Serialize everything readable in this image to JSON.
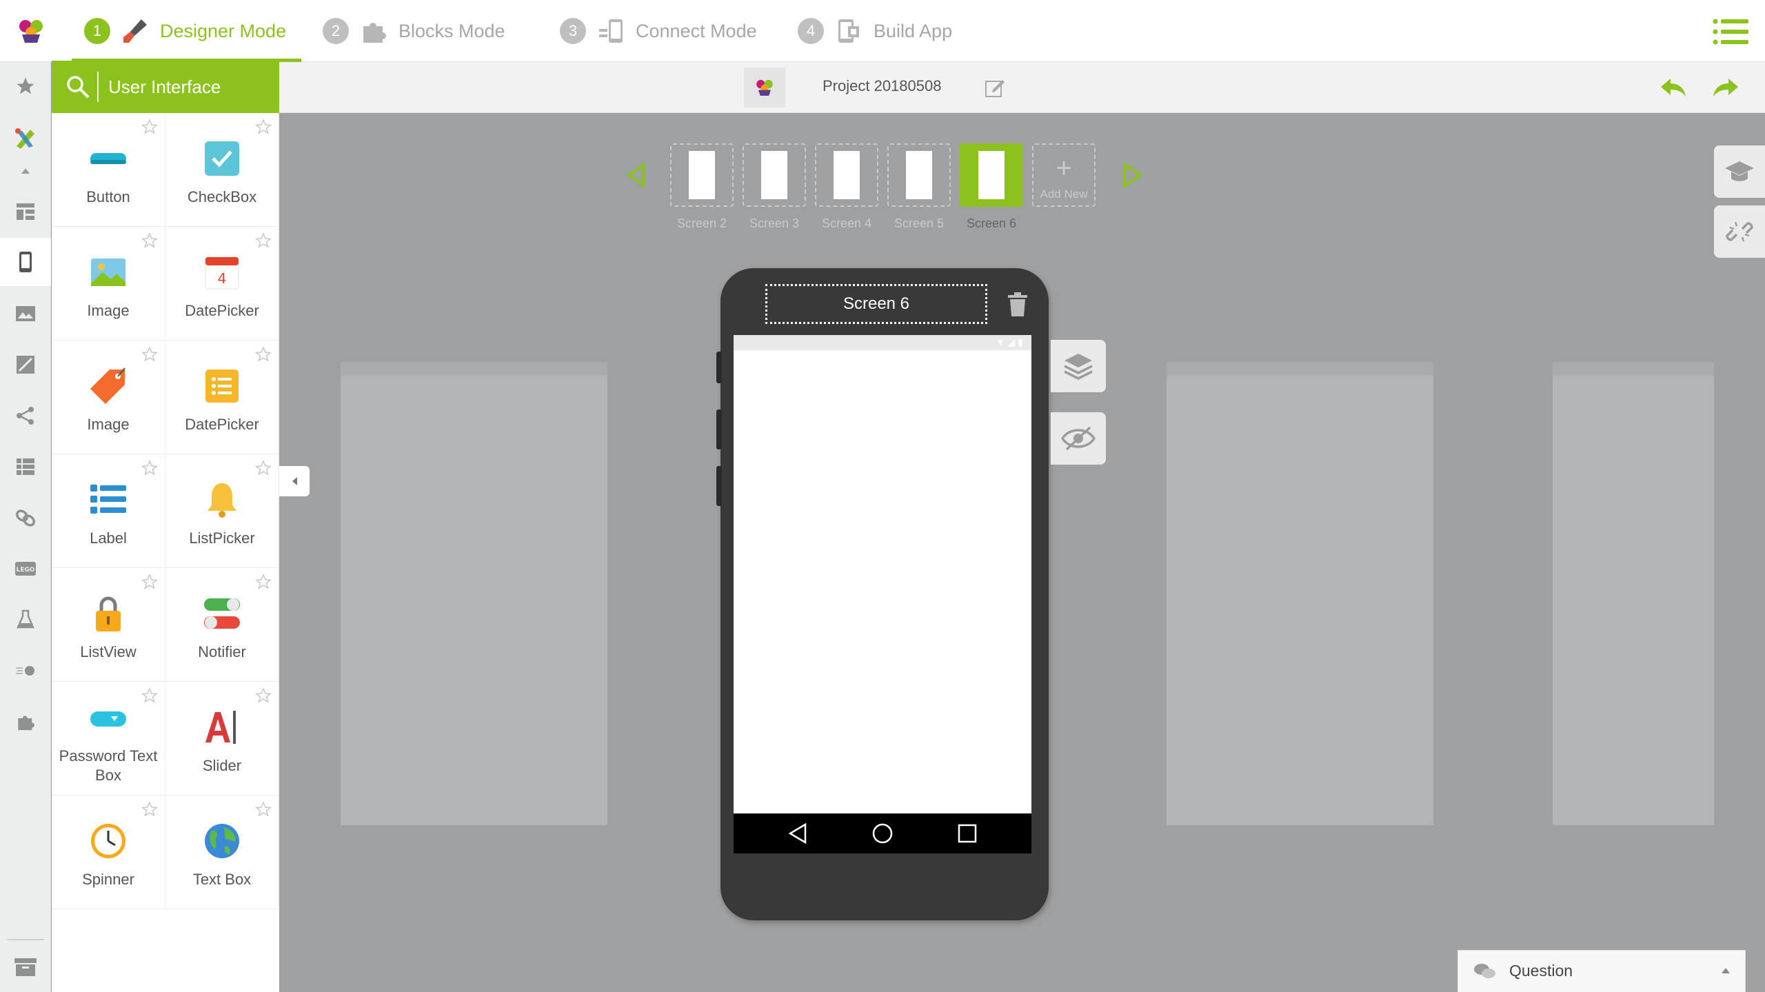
{
  "modes": [
    {
      "num": "1",
      "label": "Designer Mode",
      "icon": "paintbrush-icon",
      "active": true
    },
    {
      "num": "2",
      "label": "Blocks Mode",
      "icon": "puzzle-icon",
      "active": false
    },
    {
      "num": "3",
      "label": "Connect Mode",
      "icon": "connect-device-icon",
      "active": false
    },
    {
      "num": "4",
      "label": "Build App",
      "icon": "build-app-icon",
      "active": false
    }
  ],
  "palette": {
    "category": "User Interface",
    "items": [
      {
        "label": "Button",
        "icon": "button-icon"
      },
      {
        "label": "CheckBox",
        "icon": "checkbox-icon"
      },
      {
        "label": "Image",
        "icon": "image-icon"
      },
      {
        "label": "DatePicker",
        "icon": "calendar-icon"
      },
      {
        "label": "Image",
        "icon": "tag-icon"
      },
      {
        "label": "DatePicker",
        "icon": "list-note-icon"
      },
      {
        "label": "Label",
        "icon": "label-icon"
      },
      {
        "label": "ListPicker",
        "icon": "bell-icon"
      },
      {
        "label": "ListView",
        "icon": "lock-icon"
      },
      {
        "label": "Notifier",
        "icon": "toggle-icon"
      },
      {
        "label": "Password Text Box",
        "icon": "dropdown-icon"
      },
      {
        "label": "Slider",
        "icon": "text-cursor-icon"
      },
      {
        "label": "Spinner",
        "icon": "clock-icon"
      },
      {
        "label": "Text Box",
        "icon": "globe-icon"
      }
    ]
  },
  "project": {
    "name": "Project 20180508"
  },
  "screens": {
    "items": [
      {
        "label": "Screen 2",
        "active": false
      },
      {
        "label": "Screen 3",
        "active": false
      },
      {
        "label": "Screen 4",
        "active": false
      },
      {
        "label": "Screen 5",
        "active": false
      },
      {
        "label": "Screen 6",
        "active": true
      }
    ],
    "add_new": "Add New",
    "current": "Screen 6"
  },
  "question": {
    "label": "Question"
  },
  "colors": {
    "accent": "#8cc21d",
    "background": "#9fa0a2",
    "phone": "#39393a"
  }
}
